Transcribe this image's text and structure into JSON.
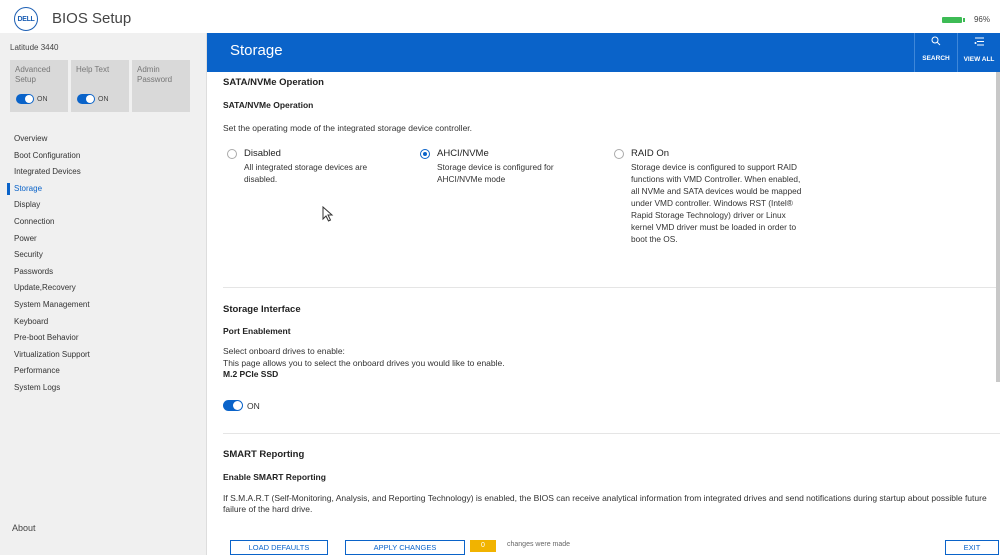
{
  "app": {
    "logo_text": "DELL",
    "title": "BIOS Setup",
    "battery": "96%"
  },
  "sidebar": {
    "device_name": "Latitude 3440",
    "options": [
      {
        "label": "Advanced Setup",
        "toggle": "ON"
      },
      {
        "label": "Help Text",
        "toggle": "ON"
      },
      {
        "label": "Admin Password"
      }
    ],
    "nav": [
      "Overview",
      "Boot Configuration",
      "Integrated Devices",
      "Storage",
      "Display",
      "Connection",
      "Power",
      "Security",
      "Passwords",
      "Update,Recovery",
      "System Management",
      "Keyboard",
      "Pre-boot Behavior",
      "Virtualization Support",
      "Performance",
      "System Logs"
    ],
    "active": "Storage",
    "about": "About"
  },
  "header": {
    "title": "Storage",
    "search_label": "SEARCH",
    "view_all_label": "VIEW ALL",
    "search_icon": "search-icon",
    "view_all_icon": "list-icon"
  },
  "sata": {
    "section_title": "SATA/NVMe Operation",
    "subtitle": "SATA/NVMe Operation",
    "description": "Set the operating mode of the integrated storage device controller.",
    "options": [
      {
        "label": "Disabled",
        "description": "All integrated storage devices are disabled.",
        "selected": false
      },
      {
        "label": "AHCI/NVMe",
        "description": "Storage device is configured for AHCI/NVMe mode",
        "selected": true
      },
      {
        "label": "RAID On",
        "description": "Storage device is configured to support RAID functions with VMD Controller. When enabled, all NVMe and SATA devices would be mapped under VMD controller. Windows RST (Intel® Rapid Storage Technology) driver or Linux kernel VMD driver must be loaded in order to boot the OS.",
        "selected": false
      }
    ]
  },
  "storage_interface": {
    "section_title": "Storage Interface",
    "subtitle": "Port Enablement",
    "desc1": "Select onboard drives to enable:",
    "desc2": "This page allows you to select the onboard drives you would like to enable.",
    "drive_label": "M.2 PCIe SSD",
    "toggle": "ON"
  },
  "smart": {
    "section_title": "SMART Reporting",
    "subtitle": "Enable SMART Reporting",
    "description": "If S.M.A.R.T (Self-Monitoring, Analysis, and Reporting Technology) is enabled, the BIOS can receive analytical information from integrated drives and send notifications during startup about possible future failure of the hard drive."
  },
  "footer": {
    "load_defaults": "LOAD DEFAULTS",
    "apply_changes": "APPLY CHANGES",
    "changes_count": "0",
    "changes_text": "changes were made",
    "exit": "EXIT"
  },
  "colors": {
    "accent": "#0a63c9",
    "changes_badge": "#f1b300",
    "battery": "#3dbb55"
  }
}
